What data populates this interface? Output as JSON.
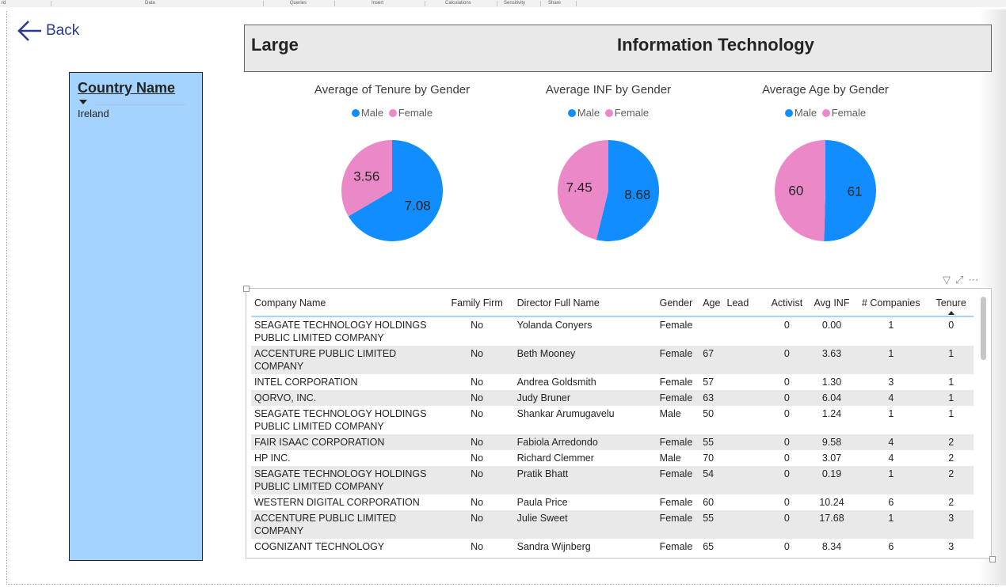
{
  "ribbon": {
    "items": [
      "rd",
      "Data",
      "Queries",
      "Insert",
      "Calculations",
      "Sensitivity",
      "Share"
    ]
  },
  "nav": {
    "back_label": "Back"
  },
  "slicer": {
    "title": "Country Name",
    "selected": "Ireland"
  },
  "header": {
    "left": "Large",
    "center": "Information Technology"
  },
  "legend": {
    "male": "Male",
    "female": "Female"
  },
  "colors": {
    "male": "#118dff",
    "female": "#eb89c8",
    "slicer_bg": "#a4d3ff"
  },
  "chart_data": [
    {
      "type": "pie",
      "title": "Average of Tenure by Gender",
      "legend": [
        "Male",
        "Female"
      ],
      "series": [
        {
          "name": "Male",
          "value": 7.08
        },
        {
          "name": "Female",
          "value": 3.56
        }
      ],
      "labels": [
        "7.08",
        "3.56"
      ]
    },
    {
      "type": "pie",
      "title": "Average INF by Gender",
      "legend": [
        "Male",
        "Female"
      ],
      "series": [
        {
          "name": "Male",
          "value": 8.68
        },
        {
          "name": "Female",
          "value": 7.45
        }
      ],
      "labels": [
        "8.68",
        "7.45"
      ]
    },
    {
      "type": "pie",
      "title": "Average Age by Gender",
      "legend": [
        "Male",
        "Female"
      ],
      "series": [
        {
          "name": "Male",
          "value": 61
        },
        {
          "name": "Female",
          "value": 60
        }
      ],
      "labels": [
        "61",
        "60"
      ]
    }
  ],
  "table": {
    "columns": [
      "Company Name",
      "Family Firm",
      "Director Full Name",
      "Gender",
      "Age",
      "Lead",
      "Activist",
      "Avg INF",
      "# Companies",
      "Tenure"
    ],
    "rows": [
      [
        "SEAGATE TECHNOLOGY HOLDINGS PUBLIC LIMITED COMPANY",
        "No",
        "Yolanda Conyers",
        "Female",
        "",
        "",
        "0",
        "0.00",
        "1",
        "0"
      ],
      [
        "ACCENTURE PUBLIC LIMITED COMPANY",
        "No",
        "Beth Mooney",
        "Female",
        "67",
        "",
        "0",
        "3.63",
        "1",
        "1"
      ],
      [
        "INTEL CORPORATION",
        "No",
        "Andrea Goldsmith",
        "Female",
        "57",
        "",
        "0",
        "1.30",
        "3",
        "1"
      ],
      [
        "QORVO, INC.",
        "No",
        "Judy Bruner",
        "Female",
        "63",
        "",
        "0",
        "6.04",
        "4",
        "1"
      ],
      [
        "SEAGATE TECHNOLOGY HOLDINGS PUBLIC LIMITED COMPANY",
        "No",
        "Shankar Arumugavelu",
        "Male",
        "50",
        "",
        "0",
        "1.24",
        "1",
        "1"
      ],
      [
        "FAIR ISAAC CORPORATION",
        "No",
        "Fabiola Arredondo",
        "Female",
        "55",
        "",
        "0",
        "9.58",
        "4",
        "2"
      ],
      [
        "HP INC.",
        "No",
        "Richard Clemmer",
        "Male",
        "70",
        "",
        "0",
        "3.07",
        "4",
        "2"
      ],
      [
        "SEAGATE TECHNOLOGY HOLDINGS PUBLIC LIMITED COMPANY",
        "No",
        "Pratik Bhatt",
        "Female",
        "54",
        "",
        "0",
        "0.19",
        "1",
        "2"
      ],
      [
        "WESTERN DIGITAL CORPORATION",
        "No",
        "Paula Price",
        "Female",
        "60",
        "",
        "0",
        "10.24",
        "6",
        "2"
      ],
      [
        "ACCENTURE PUBLIC LIMITED COMPANY",
        "No",
        "Julie Sweet",
        "Female",
        "55",
        "",
        "0",
        "17.68",
        "1",
        "3"
      ],
      [
        "COGNIZANT TECHNOLOGY",
        "No",
        "Sandra Wijnberg",
        "Female",
        "65",
        "",
        "0",
        "8.34",
        "6",
        "3"
      ]
    ]
  }
}
